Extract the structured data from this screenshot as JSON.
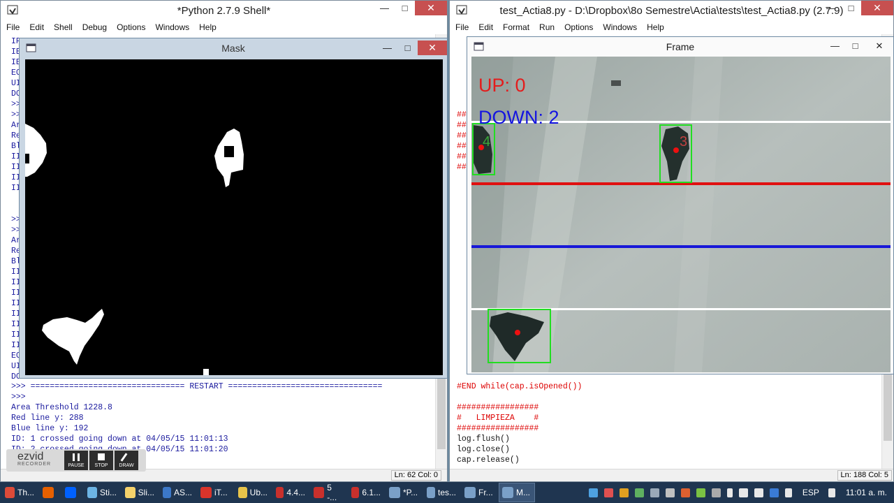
{
  "shell": {
    "title": "*Python 2.7.9 Shell*",
    "menu": [
      "File",
      "Edit",
      "Shell",
      "Debug",
      "Options",
      "Windows",
      "Help"
    ],
    "left_fragments": [
      "IP",
      "IE",
      "IE",
      "EC",
      "UI",
      "DC",
      ">>",
      ">>",
      "Ar",
      "Re",
      "Bl",
      "II",
      "II",
      "II",
      "II",
      "",
      "",
      ">>",
      ">>",
      "Ar",
      "Re",
      "Bl",
      "II",
      "II",
      "II",
      "II",
      "II",
      "II",
      "II",
      "II",
      "EC",
      "UI",
      "DC"
    ],
    "lines": [
      ">>> ================================ RESTART ================================",
      ">>> ",
      "Area Threshold 1228.8",
      "Red line y: 288",
      "Blue line y: 192",
      "ID: 1 crossed going down at 04/05/15 11:01:13",
      "ID: 2 crossed going down at 04/05/15 11:01:20"
    ],
    "status": "Ln: 62 Col: 0"
  },
  "editor": {
    "title": "test_Actia8.py - D:\\Dropbox\\8o Semestre\\Actia\\tests\\test_Actia8.py (2.7.9)",
    "menu": [
      "File",
      "Edit",
      "Format",
      "Run",
      "Options",
      "Windows",
      "Help"
    ],
    "left_fragments": [
      "##",
      "##",
      "##",
      "##",
      "##",
      "##"
    ],
    "lines": [
      "#END while(cap.isOpened())",
      "",
      "#################",
      "#   LIMPIEZA    #",
      "#################",
      "log.flush()",
      "log.close()",
      "cap.release()"
    ],
    "status": "Ln: 188 Col: 5"
  },
  "mask_window": {
    "title": "Mask"
  },
  "frame_window": {
    "title": "Frame",
    "up_text": "UP: 0",
    "down_text": "DOWN: 2",
    "id_labels": [
      "4",
      "3"
    ]
  },
  "recorder": {
    "brand": "ezvid",
    "sub": "RECORDER",
    "buttons": [
      "PAUSE",
      "STOP",
      "DRAW"
    ]
  },
  "taskbar": {
    "items": [
      {
        "label": "Th...",
        "color": "#dd4b39"
      },
      {
        "label": "",
        "color": "#e66000"
      },
      {
        "label": "",
        "color": "#0061fe"
      },
      {
        "label": "Sti...",
        "color": "#6cb4e4"
      },
      {
        "label": "Sli...",
        "color": "#f5d26b"
      },
      {
        "label": "AS...",
        "color": "#3c78c8"
      },
      {
        "label": "iT...",
        "color": "#d9342b"
      },
      {
        "label": "Ub...",
        "color": "#e8c44a"
      },
      {
        "label": "4.4...",
        "color": "#c9302c"
      },
      {
        "label": "5 -...",
        "color": "#c9302c"
      },
      {
        "label": "6.1...",
        "color": "#c9302c"
      },
      {
        "label": "*P...",
        "color": "#7aa0c8"
      },
      {
        "label": "tes...",
        "color": "#7aa0c8"
      },
      {
        "label": "Fr...",
        "color": "#7aa0c8"
      },
      {
        "label": "M...",
        "color": "#7aa0c8"
      }
    ],
    "lang": "ESP",
    "clock": "11:01 a. m."
  },
  "colors": {
    "up_text": "#e41c1c",
    "down_text": "#1414e0",
    "red_line": "#e01010",
    "blue_line": "#1818d8",
    "box": "#22dd22",
    "editor_comment": "#dd0000",
    "shell_output": "#1a1a9e"
  }
}
